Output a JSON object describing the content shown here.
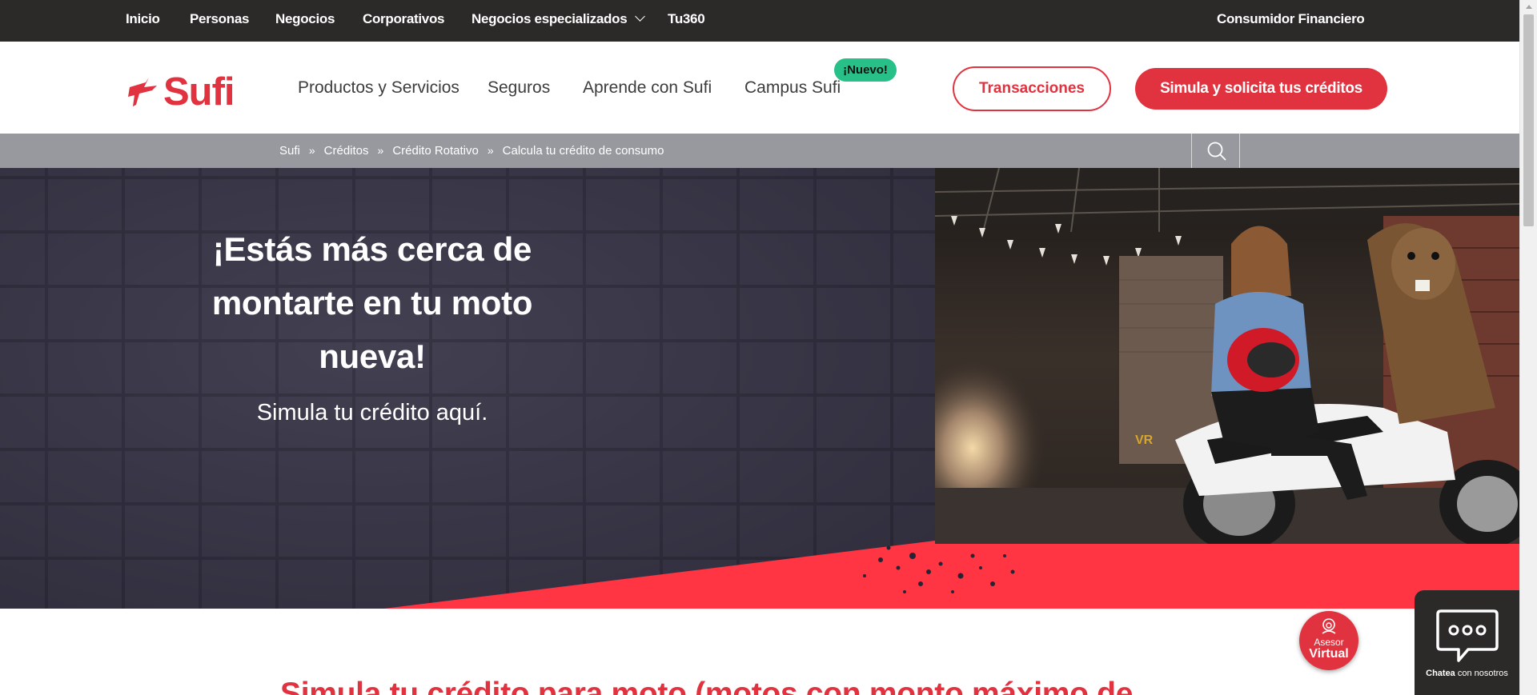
{
  "topbar": {
    "links": [
      "Inicio",
      "Personas",
      "Negocios",
      "Corporativos",
      "Negocios especializados",
      "Tu360"
    ],
    "right_link": "Consumidor Financiero"
  },
  "header": {
    "logo_text": "Sufi",
    "nav": [
      "Productos y Servicios",
      "Seguros",
      "Aprende con Sufi",
      "Campus Sufi"
    ],
    "badge_new": "¡Nuevo!",
    "btn_transacciones": "Transacciones",
    "btn_simula": "Simula y solicita tus créditos"
  },
  "breadcrumb": [
    "Sufi",
    "Créditos",
    "Crédito Rotativo",
    "Calcula tu crédito de consumo"
  ],
  "breadcrumb_sep": "»",
  "hero": {
    "title": "¡Estás más cerca de montarte en tu moto nueva!",
    "subtitle": "Simula tu crédito aquí."
  },
  "section": {
    "title": "Simula tu crédito para moto (motos con monto máximo de"
  },
  "asesor": {
    "line1": "Asesor",
    "line2": "Virtual"
  },
  "chat": {
    "bold": "Chatea",
    "rest": " con nosotros"
  },
  "colors": {
    "brand_red": "#e1333f",
    "dark": "#2b2a29",
    "breadcrumb_gray": "#97999f",
    "badge_green": "#27c088"
  },
  "icons": {
    "search": "search-icon",
    "chat": "chat-bubble-icon",
    "asesor": "headset-icon",
    "dropdown": "chevron-down-icon"
  }
}
